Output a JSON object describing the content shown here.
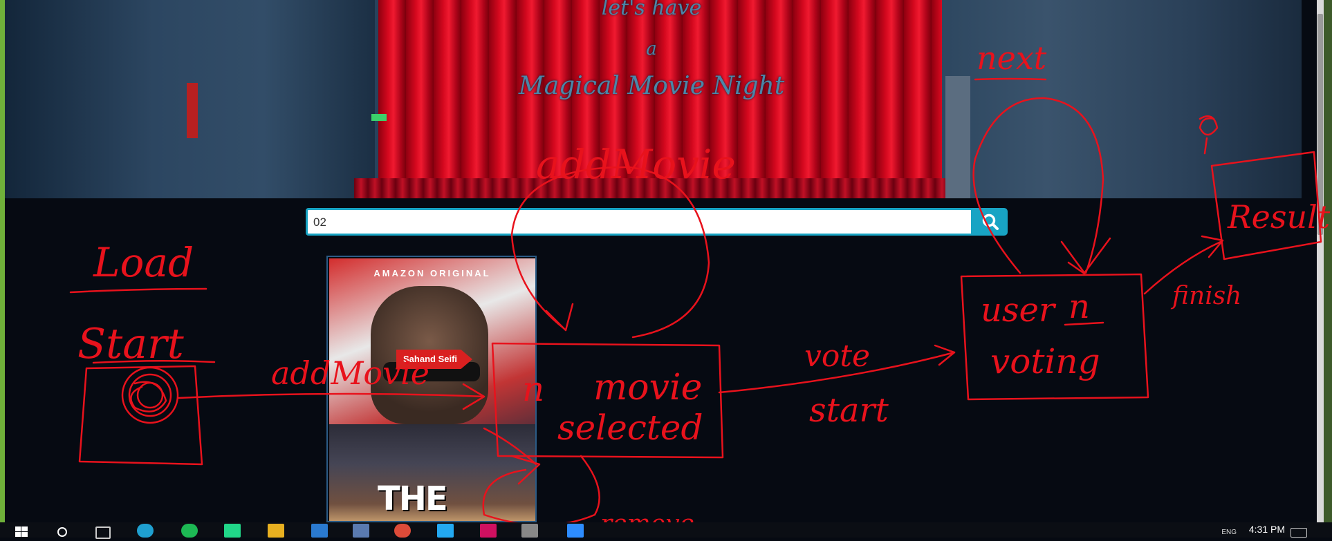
{
  "hero": {
    "line1": "let's have",
    "line2": "a",
    "line3": "Magical Movie Night"
  },
  "search": {
    "value": "02",
    "button_icon": "search-icon"
  },
  "movie_card": {
    "poster_brand": "AMAZON ORIGINAL",
    "poster_title": "THE BOYS",
    "added_by": "Sahand Seifi"
  },
  "annotations": {
    "load": "Load",
    "start": "Start",
    "add_movie_left": "addMovie",
    "add_movie_top": "addMovie",
    "n_movie_selected_n": "n",
    "n_movie_selected_movie": "movie",
    "n_movie_selected_selected": "selected",
    "remove": "remove",
    "vote": "vote",
    "vote_start": "start",
    "user_n_user": "user",
    "user_n_n": "n",
    "voting": "voting",
    "next": "next",
    "finish": "finish",
    "result": "Result"
  },
  "taskbar": {
    "clock": "4:31 PM",
    "language": "ENG"
  },
  "colors": {
    "ink": "#e8121c",
    "accent": "#18a4c4"
  }
}
